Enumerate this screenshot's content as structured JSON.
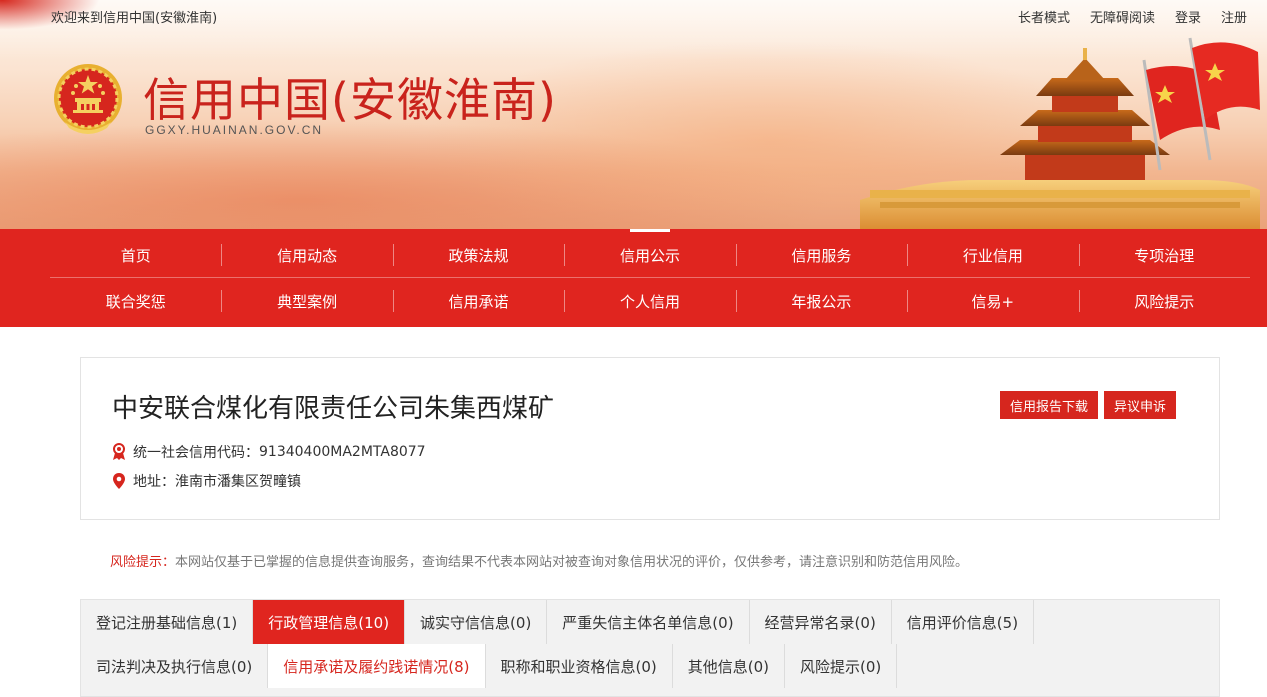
{
  "header": {
    "welcome": "欢迎来到信用中国(安徽淮南)",
    "links": [
      "长者模式",
      "无障碍阅读",
      "登录",
      "注册"
    ],
    "site_title": "信用中国(安徽淮南)",
    "site_domain": "GGXY.HUAINAN.GOV.CN"
  },
  "nav": {
    "row1": [
      "首页",
      "信用动态",
      "政策法规",
      "信用公示",
      "信用服务",
      "行业信用",
      "专项治理"
    ],
    "row2": [
      "联合奖惩",
      "典型案例",
      "信用承诺",
      "个人信用",
      "年报公示",
      "信易+",
      "风险提示"
    ],
    "active": "信用公示"
  },
  "company": {
    "name": "中安联合煤化有限责任公司朱集西煤矿",
    "code_label": "统一社会信用代码：",
    "code": "91340400MA2MTA8077",
    "address_label": "地址：",
    "address": "淮南市潘集区贺疃镇",
    "buttons": {
      "report": "信用报告下载",
      "appeal": "异议申诉"
    }
  },
  "notice": {
    "label": "风险提示：",
    "text": "本网站仅基于已掌握的信息提供查询服务，查询结果不代表本网站对被查询对象信用状况的评价，仅供参考，请注意识别和防范信用风险。"
  },
  "tabs": {
    "row1": [
      "登记注册基础信息(1)",
      "行政管理信息(10)",
      "诚实守信信息(0)",
      "严重失信主体名单信息(0)",
      "经营异常名录(0)",
      "信用评价信息(5)"
    ],
    "row2": [
      "司法判决及执行信息(0)",
      "信用承诺及履约践诺情况(8)",
      "职称和职业资格信息(0)",
      "其他信息(0)",
      "风险提示(0)"
    ],
    "active": "行政管理信息(10)",
    "highlight": "信用承诺及履约践诺情况(8)"
  },
  "colors": {
    "brand_red": "#e0251f",
    "title_red": "#c9231c"
  }
}
